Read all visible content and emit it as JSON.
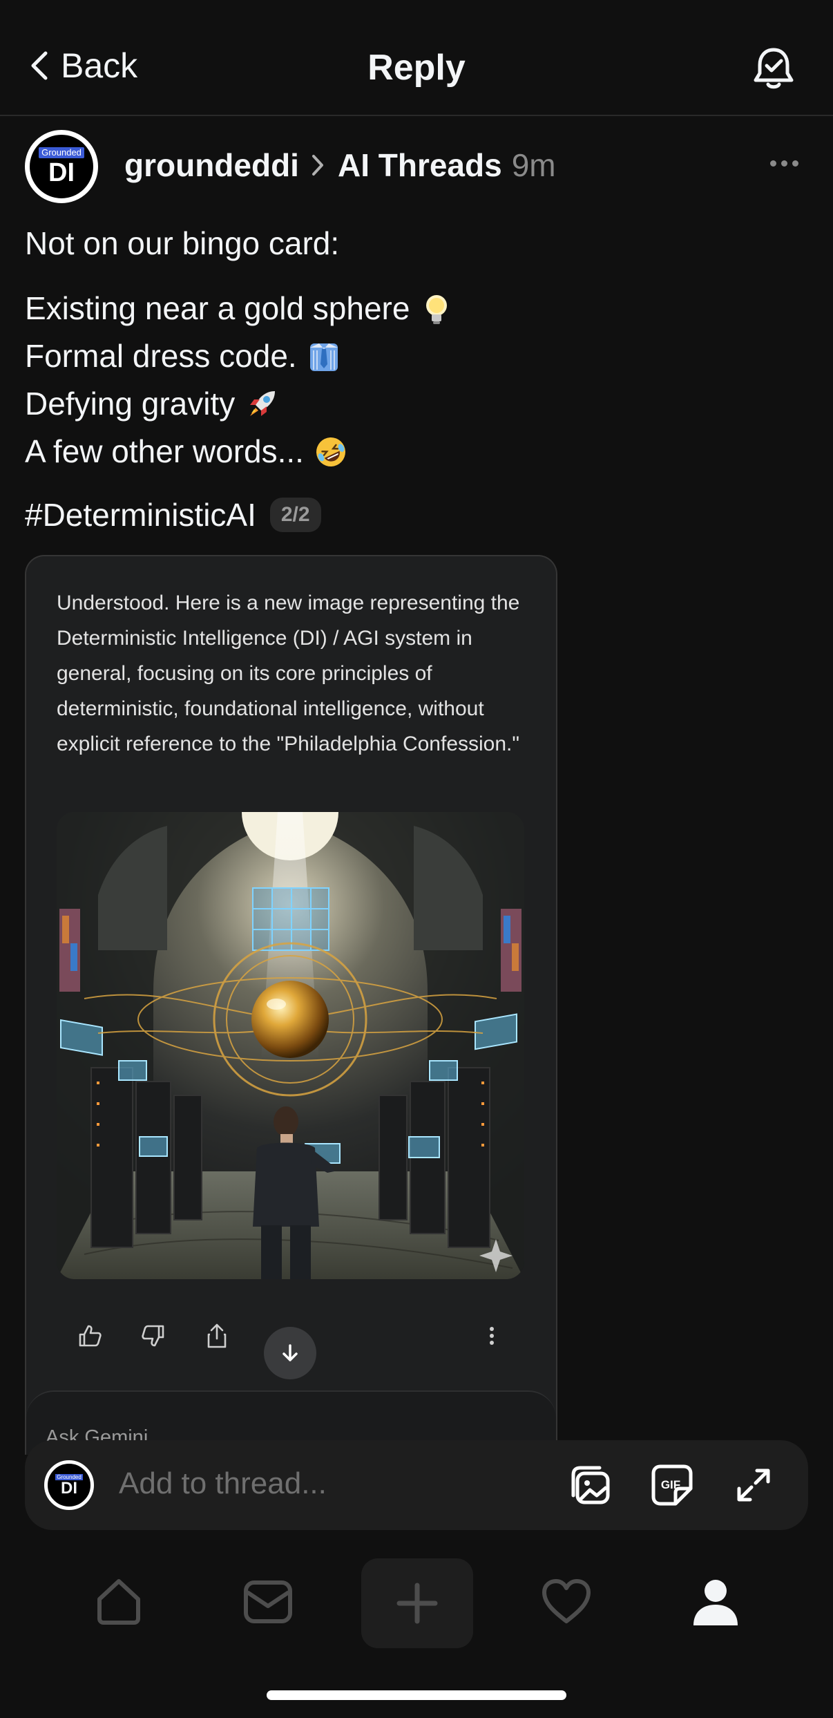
{
  "header": {
    "back_label": "Back",
    "title": "Reply"
  },
  "post": {
    "avatar": {
      "badge": "Grounded",
      "initials": "DI"
    },
    "username": "groundeddi",
    "community": "AI Threads",
    "time": "9m",
    "intro": "Not on our bingo card:",
    "lines": [
      {
        "text": "Existing near a gold sphere",
        "icon": "lightbulb-icon"
      },
      {
        "text": "Formal dress code.",
        "icon": "necktie-shirt-icon"
      },
      {
        "text": "Defying gravity",
        "icon": "rocket-icon"
      },
      {
        "text": "A few other words...",
        "icon": "rofl-emoji-icon"
      }
    ],
    "hashtag": "#DeterministicAI",
    "pager": "2/2"
  },
  "embedded": {
    "text": "Understood. Here is a new image representing the Deterministic Intelligence (DI) / AGI system in general, focusing on its core principles of deterministic, foundational intelligence, without explicit reference to the \"Philadelphia Confession.\"",
    "ask_placeholder": "Ask Gemini"
  },
  "composer": {
    "placeholder": "Add to thread...",
    "avatar": {
      "badge": "Grounded",
      "initials": "DI"
    },
    "gif_label": "GIF"
  },
  "nav": {
    "items": [
      "home-icon",
      "inbox-icon",
      "plus-icon",
      "heart-icon",
      "profile-icon"
    ]
  },
  "colors": {
    "background": "#101010",
    "text": "#f3f5f7",
    "muted": "#8a8a8a",
    "card": "#1e1f20",
    "badge_blue": "#3b5bd6",
    "gold": "#d9a441"
  }
}
